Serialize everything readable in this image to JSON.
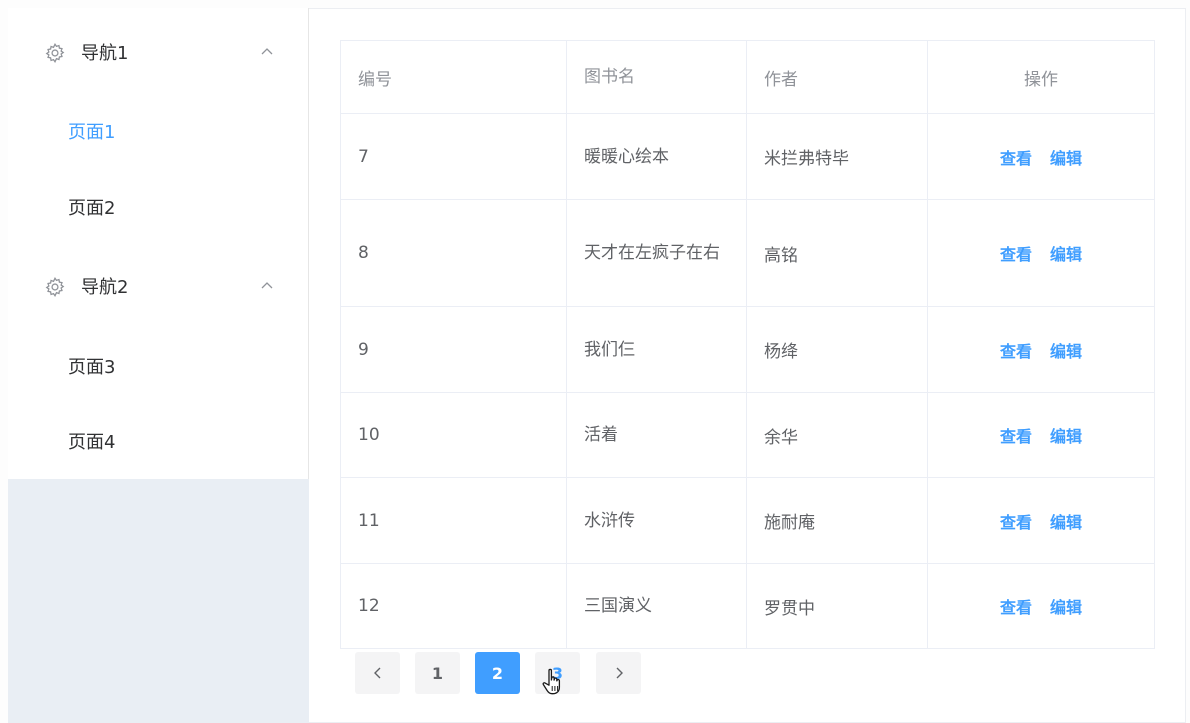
{
  "sidebar": {
    "groups": [
      {
        "title": "导航1",
        "items": [
          "页面1",
          "页面2"
        ]
      },
      {
        "title": "导航2",
        "items": [
          "页面3",
          "页面4"
        ]
      }
    ]
  },
  "table": {
    "headers": [
      "编号",
      "图书名",
      "作者",
      "操作"
    ],
    "rows": [
      {
        "id": "7",
        "name": "暖暖心绘本",
        "author": "米拦弗特毕"
      },
      {
        "id": "8",
        "name": "天才在左疯子在右",
        "author": "高铭"
      },
      {
        "id": "9",
        "name": "我们仨",
        "author": "杨绛"
      },
      {
        "id": "10",
        "name": "活着",
        "author": "余华"
      },
      {
        "id": "11",
        "name": "水浒传",
        "author": "施耐庵"
      },
      {
        "id": "12",
        "name": "三国演义",
        "author": "罗贯中"
      }
    ],
    "actions": {
      "view": "查看",
      "edit": "编辑"
    }
  },
  "pagination": {
    "pages": [
      "1",
      "2",
      "3"
    ],
    "current": "2"
  },
  "colors": {
    "accent": "#409eff",
    "sidebar_bg": "#e9eef4"
  },
  "icons": {
    "menu": "gear-icon",
    "expand": "chevron-up-icon",
    "prev": "chevron-left-icon",
    "next": "chevron-right-icon"
  }
}
